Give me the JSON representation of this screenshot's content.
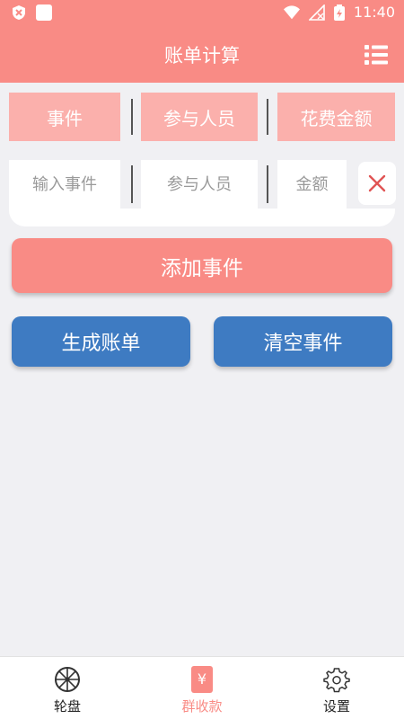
{
  "status_bar": {
    "time": "11:40"
  },
  "app_bar": {
    "title": "账单计算"
  },
  "headers": [
    "事件",
    "参与人员",
    "花费金额"
  ],
  "inputs": {
    "event_placeholder": "输入事件",
    "people_placeholder": "参与人员",
    "amount_placeholder": "金额"
  },
  "buttons": {
    "add": "添加事件",
    "generate": "生成账单",
    "clear": "清空事件"
  },
  "bottom_nav": {
    "items": [
      {
        "label": "轮盘",
        "icon": "wheel-icon"
      },
      {
        "label": "群收款",
        "icon": "yuan-receipt-icon",
        "active": true
      },
      {
        "label": "设置",
        "icon": "gear-icon"
      }
    ]
  },
  "colors": {
    "accent": "#f98b85",
    "header_cell": "#fbb0ac",
    "blue": "#3e7bc2",
    "delete": "#e05454"
  }
}
